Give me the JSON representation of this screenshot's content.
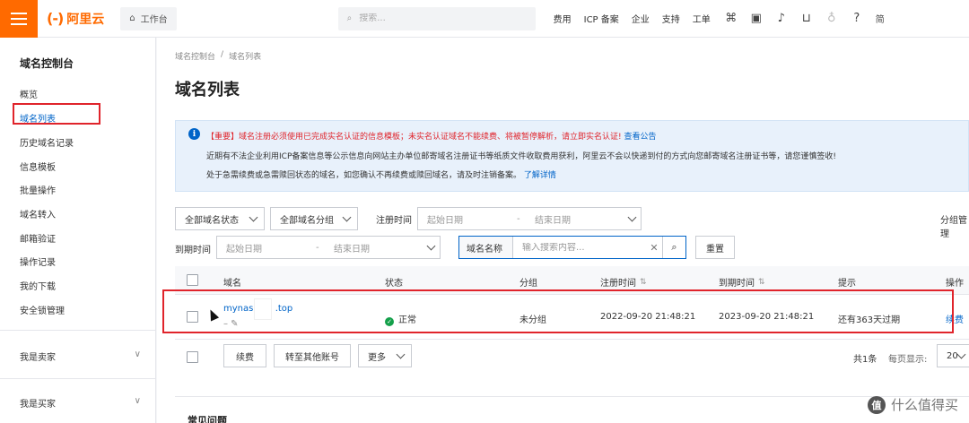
{
  "topbar": {
    "logo_text": "阿里云",
    "workbench": "工作台",
    "search_placeholder": "搜索...",
    "links": [
      "费用",
      "ICP 备案",
      "企业",
      "支持",
      "工单"
    ],
    "last_cut": "简"
  },
  "sidebar": {
    "title": "域名控制台",
    "items": [
      "概览",
      "域名列表",
      "历史域名记录",
      "信息模板",
      "批量操作",
      "域名转入",
      "邮箱验证",
      "操作记录",
      "我的下载",
      "安全锁管理"
    ],
    "groups": [
      "我是卖家",
      "我是买家"
    ]
  },
  "main": {
    "breadcrumb": [
      "域名控制台",
      "/",
      "域名列表"
    ],
    "title": "域名列表",
    "notice": {
      "line1": "【重要】域名注册必须使用已完成实名认证的信息模板；未实名认证域名不能续费、将被暂停解析，请立即实名认证!",
      "line1_link": "查看公告",
      "line2": "近期有不法企业利用ICP备案信息等公示信息向网站主办单位邮寄域名注册证书等纸质文件收取费用获利，阿里云不会以快递到付的方式向您邮寄域名注册证书等，请您谨慎签收!",
      "line3": "处于急需续费或急需赎回状态的域名，如您确认不再续费或赎回域名，请及时注销备案。",
      "line3_link": "了解详情"
    },
    "filters": {
      "status": "全部域名状态",
      "group": "全部域名分组",
      "reg_time_label": "注册时间",
      "start_date": "起始日期",
      "end_date": "结束日期",
      "expire_label": "到期时间",
      "group_manage": "分组管理",
      "search_field": "域名名称",
      "search_placeholder": "输入搜索内容...",
      "reset": "重置"
    },
    "table": {
      "headers": [
        "域名",
        "状态",
        "分组",
        "注册时间",
        "到期时间",
        "提示",
        "操作"
      ],
      "row": {
        "domain": "mynas0",
        "domain_suffix": ".top",
        "status": "正常",
        "group": "未分组",
        "reg_time": "2022-09-20 21:48:21",
        "expire_time": "2023-09-20 21:48:21",
        "tip": "还有363天过期",
        "action": "续费"
      }
    },
    "bulk": {
      "renew": "续费",
      "transfer": "转至其他账号",
      "more": "更多",
      "total": "共1条",
      "page_size_label": "每页显示:",
      "page_size": "20"
    },
    "faq_title": "常见问题"
  },
  "watermark": "什么值得买",
  "colors": {
    "brand": "#ff6a00",
    "link": "#0064c8",
    "danger": "#e0242b",
    "success": "#14a04a"
  }
}
